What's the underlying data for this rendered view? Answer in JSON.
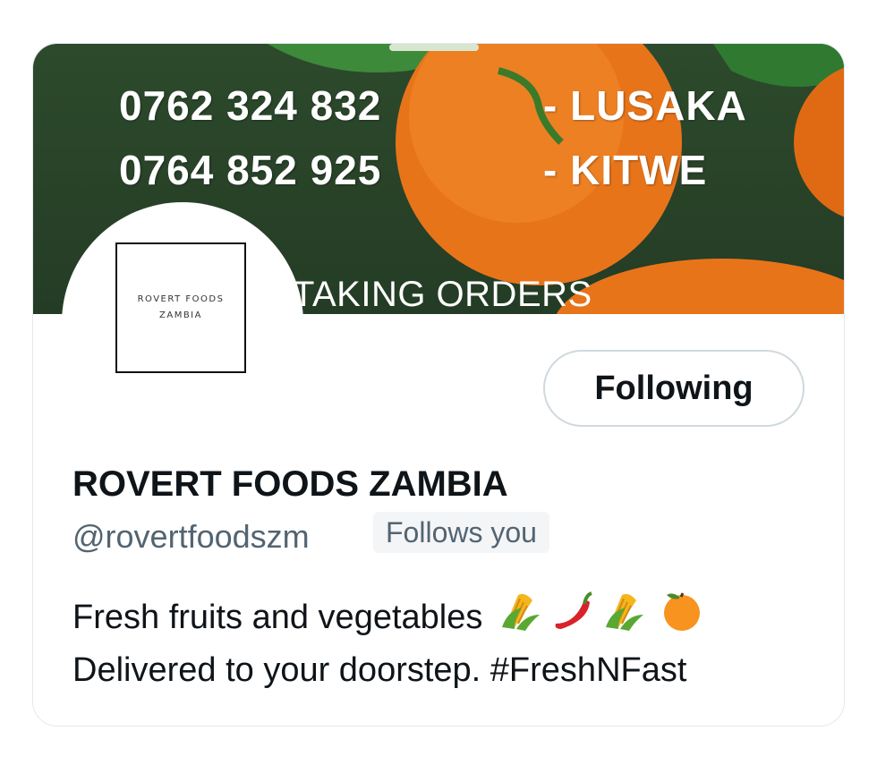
{
  "banner": {
    "phone_lusaka": "0762 324 832",
    "city_lusaka": "- LUSAKA",
    "phone_kitwe": "0764 852 925",
    "city_kitwe": "- KITWE",
    "orders_text": "TAKING ORDERS"
  },
  "avatar": {
    "line1": "ROVERT FOODS",
    "line2": "ZAMBIA"
  },
  "follow_button": {
    "label": "Following"
  },
  "profile": {
    "name": "ROVERT FOODS ZAMBIA",
    "handle": "@rovertfoodszm",
    "follows_you": "Follows you",
    "bio_line1": "Fresh fruits and vegetables",
    "bio_line2": "Delivered to your doorstep. #FreshNFast",
    "bio_emojis": [
      "corn-icon",
      "hot-pepper-icon",
      "corn-icon",
      "tangerine-icon"
    ]
  },
  "colors": {
    "banner_green": "#2d4a2c",
    "orange": "#e8741a",
    "text_primary": "#0f1419",
    "text_secondary": "#536471",
    "border": "#cfd9de"
  }
}
